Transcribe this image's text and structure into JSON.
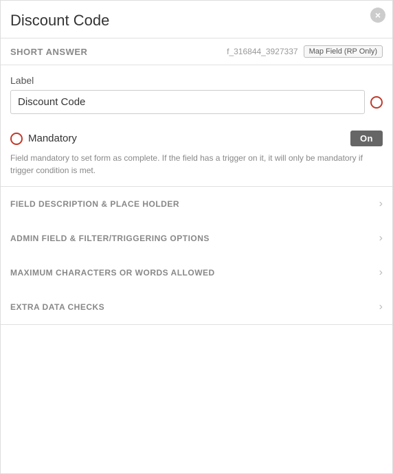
{
  "panel": {
    "title": "Discount Code",
    "close_label": "×"
  },
  "subheader": {
    "short_answer_label": "SHORT ANSWER",
    "field_id": "f_316844_3927337",
    "map_field_btn": "Map Field (RP Only)"
  },
  "label_section": {
    "label": "Label",
    "input_value": "Discount Code"
  },
  "mandatory_section": {
    "label": "Mandatory",
    "toggle_label": "On",
    "description": "Field mandatory to set form as complete. If the field has a trigger on it, it will only be mandatory if trigger condition is met."
  },
  "accordion": {
    "items": [
      {
        "label": "FIELD DESCRIPTION & PLACE HOLDER"
      },
      {
        "label": "ADMIN FIELD & FILTER/TRIGGERING OPTIONS"
      },
      {
        "label": "MAXIMUM CHARACTERS OR WORDS ALLOWED"
      },
      {
        "label": "EXTRA DATA CHECKS"
      }
    ]
  }
}
